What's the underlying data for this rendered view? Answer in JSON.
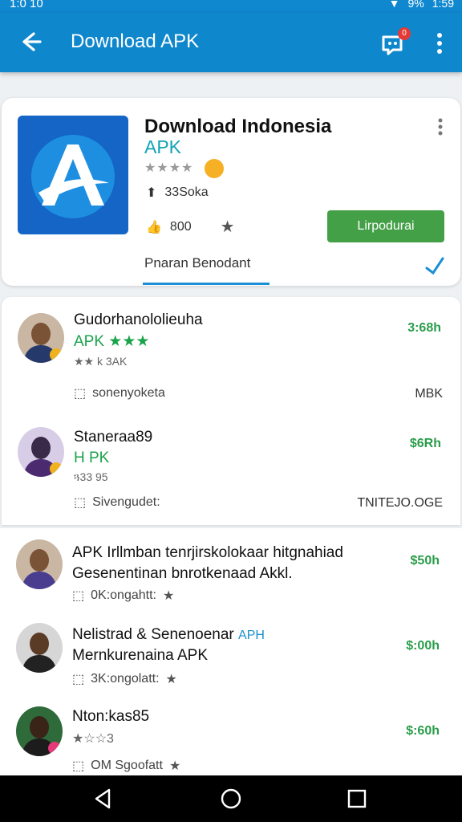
{
  "status": {
    "time_left": "1:0 10",
    "time_right": "1:59",
    "battery": "9%"
  },
  "app_bar": {
    "title": "Download APK",
    "badge": "0"
  },
  "app": {
    "title": "Download Indonesia",
    "subtitle": "APK",
    "stars": "★★★★",
    "downloads": "33Soka",
    "likes": "800",
    "install_label": "Lirpodurai",
    "tab_label": "Pnaran Benodant"
  },
  "items": [
    {
      "title": "Gudorhanololieuha",
      "sub": "APK ★★★",
      "rating": "★★ k 3AK",
      "meta": "sonenyoketa",
      "price": "3:68h",
      "size": "MBK"
    },
    {
      "title": "Staneraa89",
      "sub": "H PK",
      "rating": "ጓ33 95",
      "meta": "Sivengudet:",
      "price": "$6Rh",
      "size": "TNITEJO.OGE"
    },
    {
      "title": "APK Irllmban tenrjirskolokaar hitgnahiad",
      "sub": "Gesenentinan bnrotkenaad Akkl.",
      "meta": "0K:ongahtt:",
      "price": "$50h"
    },
    {
      "title": "Nelistrad & Senenoenar",
      "title_tag": "APH",
      "sub": "Mernkurenaina APK",
      "meta": "3K:ongolatt:",
      "price": "$:00h"
    },
    {
      "title": "Nton:kas85",
      "rating": "★☆☆3",
      "meta": "OM Sgoofatt",
      "price": "$:60h"
    }
  ],
  "colors": {
    "primary": "#0f87cc",
    "install": "#43a047",
    "price": "#2a9d4a"
  }
}
